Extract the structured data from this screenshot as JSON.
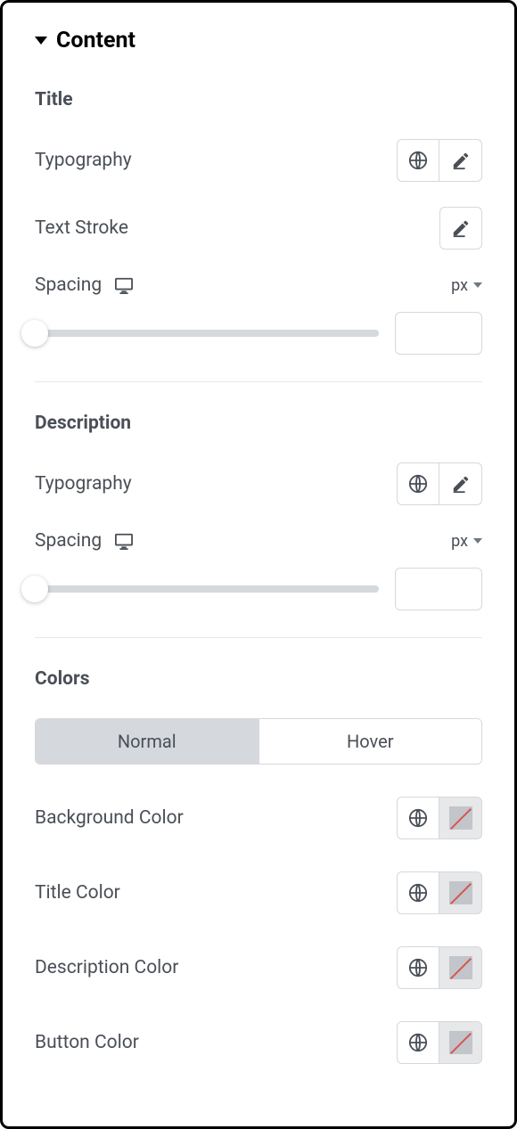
{
  "header": {
    "title": "Content"
  },
  "title_section": {
    "heading": "Title",
    "typography_label": "Typography",
    "text_stroke_label": "Text Stroke",
    "spacing_label": "Spacing",
    "spacing_unit": "px",
    "spacing_value": ""
  },
  "description_section": {
    "heading": "Description",
    "typography_label": "Typography",
    "spacing_label": "Spacing",
    "spacing_unit": "px",
    "spacing_value": ""
  },
  "colors_section": {
    "heading": "Colors",
    "tabs": {
      "normal": "Normal",
      "hover": "Hover"
    },
    "rows": [
      {
        "label": "Background Color"
      },
      {
        "label": "Title Color"
      },
      {
        "label": "Description Color"
      },
      {
        "label": "Button Color"
      }
    ]
  }
}
